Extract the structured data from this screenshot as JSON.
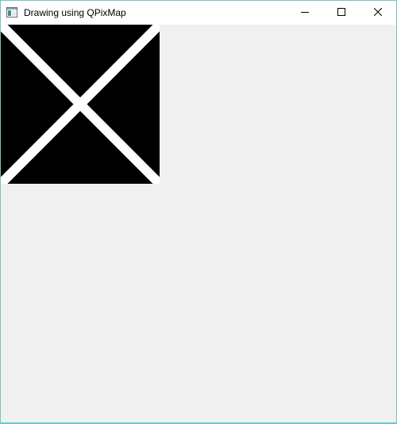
{
  "window": {
    "title": "Drawing using QPixMap",
    "border_color": "#6ec6c9",
    "client_background": "#f0f0f0"
  },
  "title_bar": {
    "app_icon": "qt-window-icon",
    "minimize_icon": "minimize-icon",
    "maximize_icon": "maximize-icon",
    "close_icon": "close-icon"
  },
  "pixmap": {
    "background_color": "#000000",
    "line_color": "#ffffff",
    "shape": "two white diagonal lines forming an X on a black square"
  }
}
